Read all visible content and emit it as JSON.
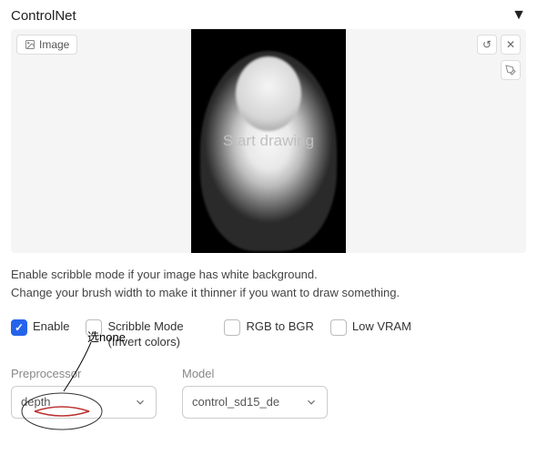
{
  "header": {
    "title": "ControlNet",
    "toggle": "▼"
  },
  "canvas": {
    "tab_label": "Image",
    "placeholder": "Start drawing",
    "undo_icon": "↺",
    "close_icon": "✕",
    "brush_icon": "🖌"
  },
  "info": {
    "line1": "Enable scribble mode if your image has white background.",
    "line2": "Change your brush width to make it thinner if you want to draw something."
  },
  "options": {
    "enable": {
      "label": "Enable",
      "checked": true
    },
    "scribble": {
      "label": "Scribble Mode (Invert colors)",
      "checked": false
    },
    "rgb2bgr": {
      "label": "RGB to BGR",
      "checked": false
    },
    "lowvram": {
      "label": "Low VRAM",
      "checked": false
    }
  },
  "annotation": {
    "text": "选none"
  },
  "fields": {
    "preprocessor": {
      "label": "Preprocessor",
      "value": "depth"
    },
    "model": {
      "label": "Model",
      "value": "control_sd15_de"
    }
  }
}
